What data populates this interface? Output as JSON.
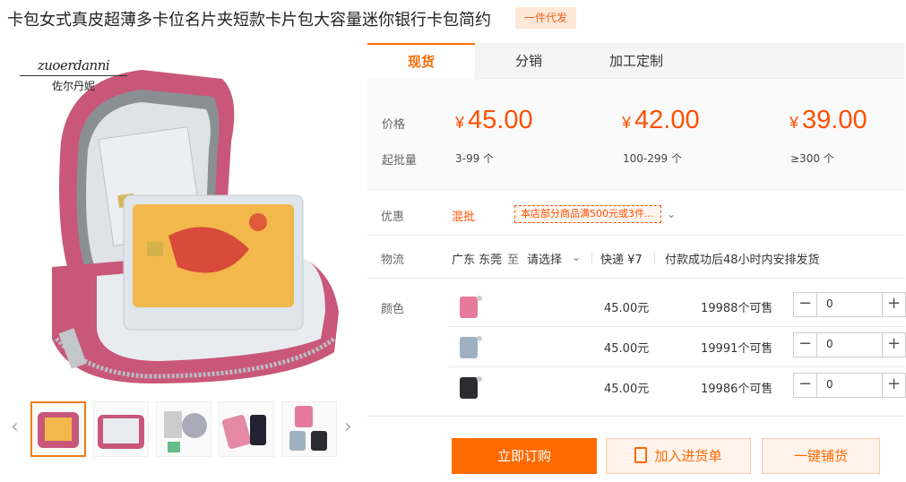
{
  "product": {
    "title": "卡包女式真皮超薄多卡位名片夹短款卡片包大容量迷你银行卡包简约",
    "tag": "一件代发",
    "brand_en": "zuoerdanni",
    "brand_cn": "佐尔丹妮"
  },
  "tabs": [
    {
      "label": "现货",
      "active": true
    },
    {
      "label": "分销",
      "active": false
    },
    {
      "label": "加工定制",
      "active": false
    }
  ],
  "pricing": {
    "price_label": "价格",
    "qty_label": "起批量",
    "currency": "¥",
    "tiers": [
      {
        "price": "45.00",
        "qty": "3-99 个"
      },
      {
        "price": "42.00",
        "qty": "100-299 个"
      },
      {
        "price": "39.00",
        "qty": "≥300 个"
      }
    ]
  },
  "promo": {
    "label": "优惠",
    "type": "混批",
    "text": "本店部分商品满500元或3件..."
  },
  "shipping": {
    "label": "物流",
    "origin": "广东 东莞",
    "to": "至",
    "destination": "请选择",
    "express": "快递 ¥7",
    "note": "付款成功后48小时内安排发货"
  },
  "variants": {
    "label": "颜色",
    "items": [
      {
        "color": "#e77a9c",
        "price": "45.00元",
        "stock": "19988个可售",
        "qty": "0"
      },
      {
        "color": "#9fb1c0",
        "price": "45.00元",
        "stock": "19991个可售",
        "qty": "0"
      },
      {
        "color": "#2b2b30",
        "price": "45.00元",
        "stock": "19986个可售",
        "qty": "0"
      }
    ]
  },
  "actions": {
    "buy": "立即订购",
    "cart": "加入进货单",
    "one_click": "一键铺货"
  },
  "colors": {
    "accent": "#ff6a00",
    "price": "#ff5000",
    "wallet": "#c9577a"
  }
}
